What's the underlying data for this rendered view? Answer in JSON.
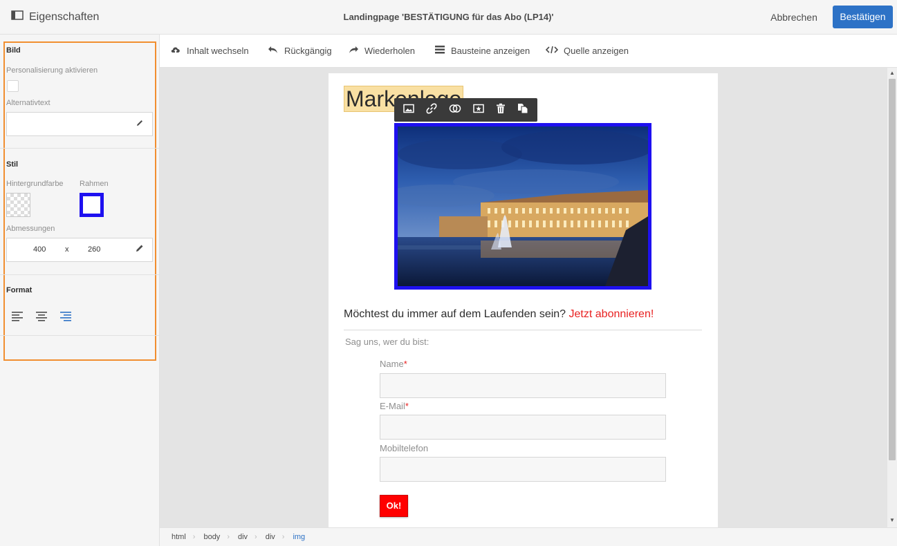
{
  "header": {
    "properties_label": "Eigenschaften",
    "title": "Landingpage 'BESTÄTIGUNG für das Abo (LP14)'",
    "cancel_label": "Abbrechen",
    "confirm_label": "Bestätigen"
  },
  "panel": {
    "image_section": "Bild",
    "personalization_label": "Personalisierung aktivieren",
    "personalization_checked": false,
    "alt_text_label": "Alternativtext",
    "alt_text_value": "",
    "style_section": "Stil",
    "background_label": "Hintergrundfarbe",
    "border_label": "Rahmen",
    "border_color": "#1e10f0",
    "dimensions_label": "Abmessungen",
    "width_value": "400",
    "dim_separator": "x",
    "height_value": "260",
    "format_section": "Format",
    "alignment_selected": "right"
  },
  "toolbar": {
    "switch_content": "Inhalt wechseln",
    "undo": "Rückgängig",
    "redo": "Wiederholen",
    "show_blocks": "Bausteine anzeigen",
    "show_source": "Quelle anzeigen"
  },
  "content": {
    "logo_text": "Markenlogo",
    "headline_text": "Möchtest du immer auf dem Laufenden sein?",
    "headline_cta": "Jetzt abonnieren!",
    "intro": "Sag uns, wer du bist:",
    "fields": [
      {
        "label": "Name",
        "required_mark": "*"
      },
      {
        "label": "E-Mail",
        "required_mark": "*"
      },
      {
        "label": "Mobiltelefon",
        "required_mark": ""
      }
    ],
    "submit_label": "Ok!"
  },
  "image_toolbar": [
    "image-icon",
    "link-icon",
    "personalize-icon",
    "star-icon",
    "trash-icon",
    "duplicate-icon"
  ],
  "breadcrumb": [
    "html",
    "body",
    "div",
    "div",
    "img"
  ],
  "colors": {
    "accent": "#2d72c6",
    "highlight": "#f18e2f",
    "cta": "#e82020",
    "submit": "#ff0000"
  }
}
